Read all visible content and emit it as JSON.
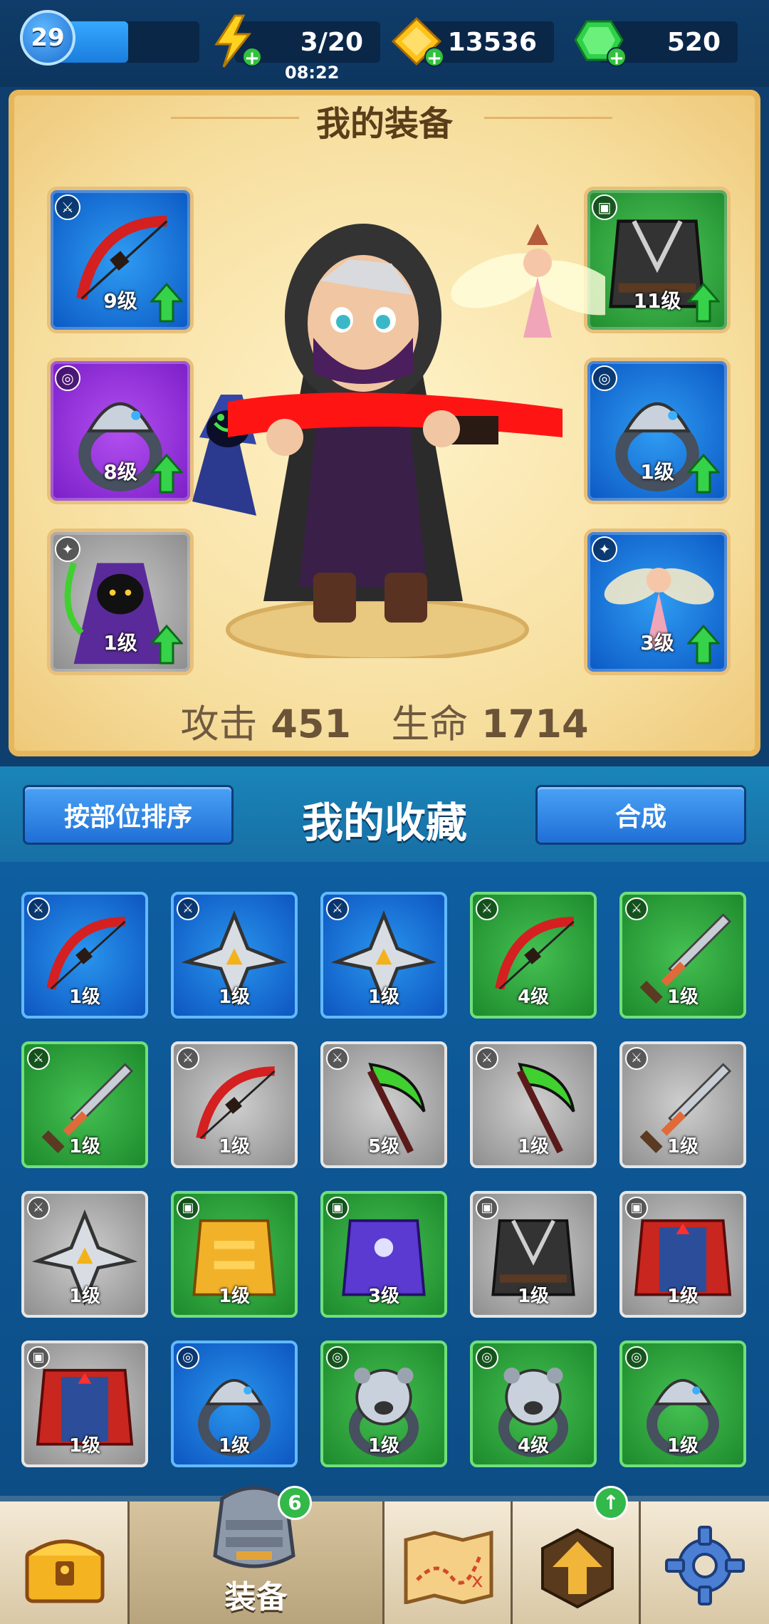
{
  "top_bar": {
    "player_level": "29",
    "xp_fraction": 0.5,
    "energy": "3/20",
    "energy_timer": "08:22",
    "gold": "13536",
    "gems": "520"
  },
  "equipment_panel": {
    "title": "我的装备",
    "left_slots": [
      {
        "level": "9级",
        "rarity": "blue",
        "kind": "bow",
        "badge": "weapon"
      },
      {
        "level": "8级",
        "rarity": "purple",
        "kind": "ring",
        "badge": "ring"
      },
      {
        "level": "1级",
        "rarity": "gray",
        "kind": "pet-reaper",
        "badge": "pet"
      }
    ],
    "right_slots": [
      {
        "level": "11级",
        "rarity": "green",
        "kind": "armor",
        "badge": "armor"
      },
      {
        "level": "1级",
        "rarity": "blue",
        "kind": "ring",
        "badge": "ring"
      },
      {
        "level": "3级",
        "rarity": "blue",
        "kind": "pet-fairy",
        "badge": "pet"
      }
    ],
    "attack_label": "攻击",
    "attack_value": "451",
    "hp_label": "生命",
    "hp_value": "1714"
  },
  "collection": {
    "sort_button": "按部位排序",
    "title": "我的收藏",
    "merge_button": "合成",
    "items": [
      {
        "level": "1级",
        "rarity": "blue",
        "kind": "bow"
      },
      {
        "level": "1级",
        "rarity": "blue",
        "kind": "star"
      },
      {
        "level": "1级",
        "rarity": "blue",
        "kind": "star"
      },
      {
        "level": "4级",
        "rarity": "green",
        "kind": "bow"
      },
      {
        "level": "1级",
        "rarity": "green",
        "kind": "sword"
      },
      {
        "level": "1级",
        "rarity": "green",
        "kind": "sword"
      },
      {
        "level": "1级",
        "rarity": "gray",
        "kind": "bow"
      },
      {
        "level": "5级",
        "rarity": "gray",
        "kind": "scythe"
      },
      {
        "level": "1级",
        "rarity": "gray",
        "kind": "scythe"
      },
      {
        "level": "1级",
        "rarity": "gray",
        "kind": "sword"
      },
      {
        "level": "1级",
        "rarity": "gray",
        "kind": "star"
      },
      {
        "level": "1级",
        "rarity": "green",
        "kind": "gold-armor"
      },
      {
        "level": "3级",
        "rarity": "green",
        "kind": "purple-armor"
      },
      {
        "level": "1级",
        "rarity": "gray",
        "kind": "armor"
      },
      {
        "level": "1级",
        "rarity": "gray",
        "kind": "red-armor"
      },
      {
        "level": "1级",
        "rarity": "gray",
        "kind": "red-armor"
      },
      {
        "level": "1级",
        "rarity": "blue",
        "kind": "ring"
      },
      {
        "level": "1级",
        "rarity": "green",
        "kind": "bear-ring"
      },
      {
        "level": "4级",
        "rarity": "green",
        "kind": "bear-ring"
      },
      {
        "level": "1级",
        "rarity": "green",
        "kind": "ring"
      }
    ]
  },
  "bottom_nav": {
    "equip_label": "装备",
    "equip_badge": "6"
  }
}
